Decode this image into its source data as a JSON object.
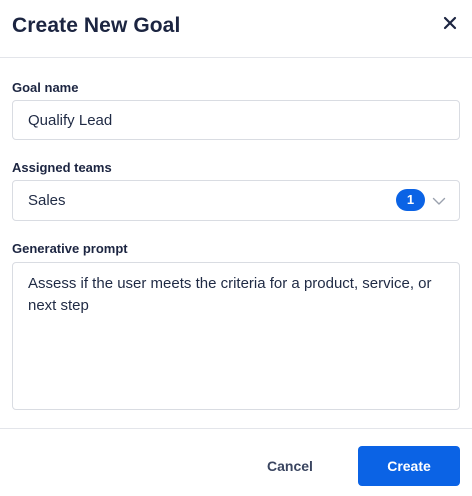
{
  "modal": {
    "title": "Create New Goal",
    "close_icon": "close-icon"
  },
  "fields": {
    "goal_name": {
      "label": "Goal name",
      "value": "Qualify Lead"
    },
    "assigned_teams": {
      "label": "Assigned teams",
      "selected": "Sales",
      "count": "1",
      "icon": "chevron-down-icon"
    },
    "generative_prompt": {
      "label": "Generative prompt",
      "value": "Assess if the user meets the criteria for a product, service, or next step"
    }
  },
  "footer": {
    "cancel_label": "Cancel",
    "create_label": "Create"
  },
  "colors": {
    "accent": "#0b63e5",
    "title": "#1c2541",
    "border": "#d9dce2"
  }
}
